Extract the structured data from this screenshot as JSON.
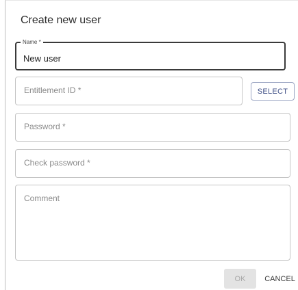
{
  "dialog": {
    "title": "Create new user"
  },
  "form": {
    "name": {
      "label": "Name *",
      "value": "New user"
    },
    "entitlement": {
      "placeholder": "Entitlement ID *"
    },
    "password": {
      "placeholder": "Password *"
    },
    "check_password": {
      "placeholder": "Check password *"
    },
    "comment": {
      "placeholder": "Comment"
    }
  },
  "buttons": {
    "select_label": "SELECT",
    "ok_label": "OK",
    "cancel_label": "CANCEL"
  }
}
